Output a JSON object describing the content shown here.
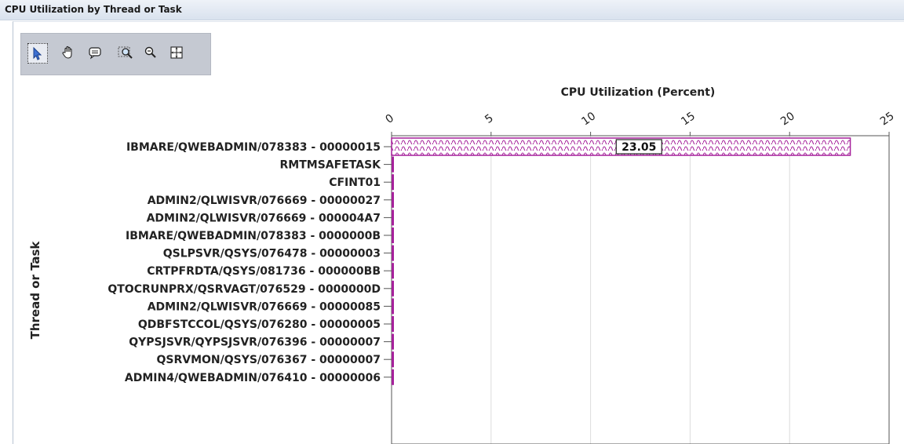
{
  "panel": {
    "title": "CPU Utilization by Thread or Task"
  },
  "toolbar": {
    "tools": [
      "pointer-icon",
      "pan-hand-icon",
      "comment-icon",
      "zoom-box-icon",
      "zoom-out-icon",
      "fit-icon"
    ]
  },
  "chart_data": {
    "type": "bar",
    "orientation": "horizontal",
    "xlabel": "CPU Utilization (Percent)",
    "ylabel": "Thread or Task",
    "xlim": [
      0,
      25
    ],
    "xticks": [
      0,
      5,
      10,
      15,
      20,
      25
    ],
    "grid": true,
    "bar_color": "#a6219b",
    "categories": [
      "IBMARE/QWEBADMIN/078383 - 00000015",
      "RMTMSAFETASK",
      "CFINT01",
      "ADMIN2/QLWISVR/076669 - 00000027",
      "ADMIN2/QLWISVR/076669 - 000004A7",
      "IBMARE/QWEBADMIN/078383 - 0000000B",
      "QSLPSVR/QSYS/076478 - 00000003",
      "CRTPFRDTA/QSYS/081736 - 000000BB",
      "QTOCRUNPRX/QSRVAGT/076529 - 0000000D",
      "ADMIN2/QLWISVR/076669 - 00000085",
      "QDBFSTCCOL/QSYS/076280 - 00000005",
      "QYPSJSVR/QYPSJSVR/076396 - 00000007",
      "QSRVMON/QSYS/076367 - 00000007",
      "ADMIN4/QWEBADMIN/076410 - 00000006"
    ],
    "values": [
      23.05,
      0.1,
      0.1,
      0.05,
      0.05,
      0.05,
      0.05,
      0.05,
      0.05,
      0.05,
      0.05,
      0.05,
      0.05,
      0.05
    ],
    "data_labels": [
      "23.05"
    ]
  }
}
